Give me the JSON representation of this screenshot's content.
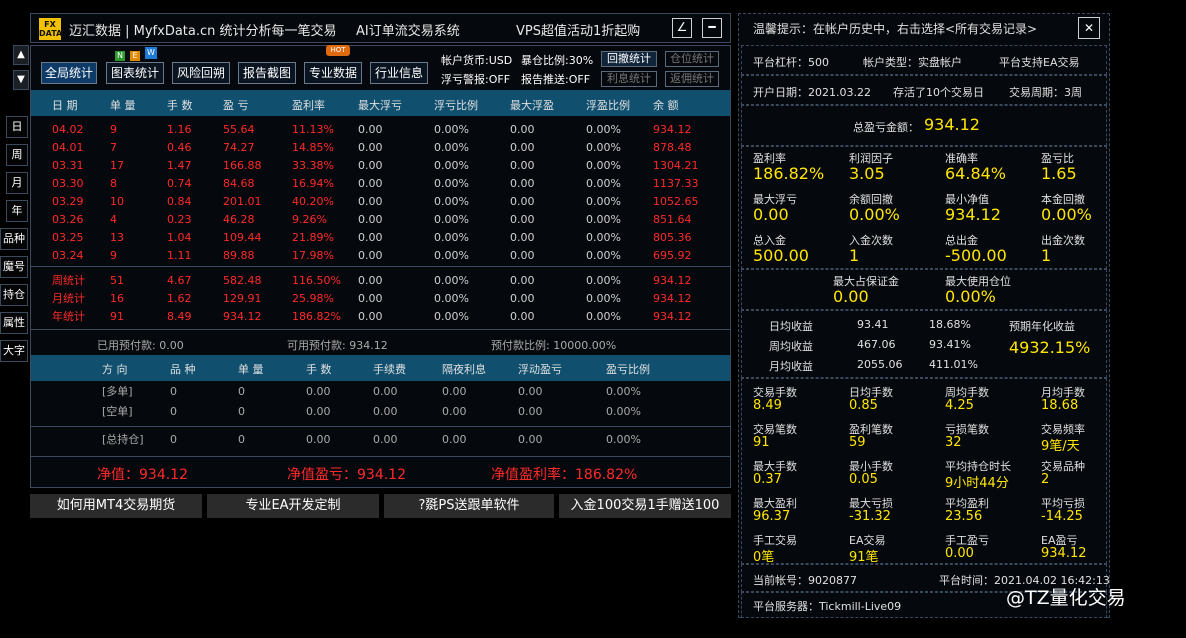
{
  "title": {
    "logo_top": "FX",
    "logo_bottom": "DATA",
    "app": "迈汇数据 | MyfxData.cn  统计分析每一笔交易",
    "ai": "AI订单流交易系统",
    "vps": "VPS超值活动1折起购",
    "btn_edit": "∠",
    "btn_min": "━"
  },
  "side": {
    "up": "▲",
    "down": "▼",
    "tabs": [
      "日",
      "周",
      "月",
      "年",
      "品种",
      "魔号",
      "持仓",
      "属性",
      "大字"
    ]
  },
  "toolbar": {
    "buttons": [
      "全局统计",
      "图表统计",
      "风险回朔",
      "报告截图",
      "专业数据",
      "行业信息"
    ],
    "new_badge": [
      "N",
      "E",
      "W"
    ],
    "hot_badge": "HOT",
    "currency": "帐户货币:USD",
    "ratio": "暴仓比例:30%",
    "warn": "浮亏警报:OFF",
    "push": "报告推送:OFF",
    "small": [
      "回撤统计",
      "仓位统计",
      "利息统计",
      "返佣统计"
    ]
  },
  "table": {
    "headers": [
      "日 期",
      "单 量",
      "手 数",
      "盈 亏",
      "盈利率",
      "最大浮亏",
      "浮亏比例",
      "最大浮盈",
      "浮盈比例",
      "余 额"
    ],
    "rows": [
      [
        "04.02",
        "9",
        "1.16",
        "55.64",
        "11.13%",
        "0.00",
        "0.00%",
        "0.00",
        "0.00%",
        "934.12"
      ],
      [
        "04.01",
        "7",
        "0.46",
        "74.27",
        "14.85%",
        "0.00",
        "0.00%",
        "0.00",
        "0.00%",
        "878.48"
      ],
      [
        "03.31",
        "17",
        "1.47",
        "166.88",
        "33.38%",
        "0.00",
        "0.00%",
        "0.00",
        "0.00%",
        "1304.21"
      ],
      [
        "03.30",
        "8",
        "0.74",
        "84.68",
        "16.94%",
        "0.00",
        "0.00%",
        "0.00",
        "0.00%",
        "1137.33"
      ],
      [
        "03.29",
        "10",
        "0.84",
        "201.01",
        "40.20%",
        "0.00",
        "0.00%",
        "0.00",
        "0.00%",
        "1052.65"
      ],
      [
        "03.26",
        "4",
        "0.23",
        "46.28",
        "9.26%",
        "0.00",
        "0.00%",
        "0.00",
        "0.00%",
        "851.64"
      ],
      [
        "03.25",
        "13",
        "1.04",
        "109.44",
        "21.89%",
        "0.00",
        "0.00%",
        "0.00",
        "0.00%",
        "805.36"
      ],
      [
        "03.24",
        "9",
        "1.11",
        "89.88",
        "17.98%",
        "0.00",
        "0.00%",
        "0.00",
        "0.00%",
        "695.92"
      ]
    ],
    "summary": [
      [
        "周统计",
        "51",
        "4.67",
        "582.48",
        "116.50%",
        "0.00",
        "0.00%",
        "0.00",
        "0.00%",
        "934.12"
      ],
      [
        "月统计",
        "16",
        "1.62",
        "129.91",
        "25.98%",
        "0.00",
        "0.00%",
        "0.00",
        "0.00%",
        "934.12"
      ],
      [
        "年统计",
        "91",
        "8.49",
        "934.12",
        "186.82%",
        "0.00",
        "0.00%",
        "0.00",
        "0.00%",
        "934.12"
      ]
    ]
  },
  "margin": {
    "used": "已用预付款: 0.00",
    "avail": "可用预付款: 934.12",
    "ratio": "预付款比例: 10000.00%"
  },
  "pos": {
    "headers": [
      "方 向",
      "品 种",
      "单 量",
      "手 数",
      "手续费",
      "隔夜利息",
      "浮动盈亏",
      "盈亏比例"
    ],
    "rows": [
      [
        "[多单]",
        "0",
        "0",
        "0.00",
        "0.00",
        "0.00",
        "0.00",
        "0.00%"
      ],
      [
        "[空单]",
        "0",
        "0",
        "0.00",
        "0.00",
        "0.00",
        "0.00",
        "0.00%"
      ]
    ],
    "total": [
      "[总持仓]",
      "0",
      "0",
      "0.00",
      "0.00",
      "0.00",
      "0.00",
      "0.00%"
    ]
  },
  "net": {
    "value": "净值：934.12",
    "profit": "净值盈亏：934.12",
    "rate": "净值盈利率：186.82%"
  },
  "footer": [
    "如何用MT4交易期货",
    "专业EA开发定制",
    "?毲PS送跟单软件",
    "入金100交易1手赠送100"
  ],
  "right": {
    "tip": "温馨提示：在帐户历史中，右击选择<所有交易记录>",
    "close": "✕",
    "lev": "平台杠杆：500",
    "acct_type": "帐户类型：实盘帐户",
    "ea": "平台支持EA交易",
    "open": "开户日期：2021.03.22",
    "stored": "存活了10个交易日",
    "period": "交易周期：3周",
    "total_label": "总盈亏金额：",
    "total_val": "934.12",
    "g1": [
      [
        "盈利率",
        "186.82%"
      ],
      [
        "利润因子",
        "3.05"
      ],
      [
        "准确率",
        "64.84%"
      ],
      [
        "盈亏比",
        "1.65"
      ],
      [
        "最大浮亏",
        "0.00"
      ],
      [
        "余额回撤",
        "0.00%"
      ],
      [
        "最小净值",
        "934.12"
      ],
      [
        "本金回撤",
        "0.00%"
      ],
      [
        "总入金",
        "500.00"
      ],
      [
        "入金次数",
        "1"
      ],
      [
        "总出金",
        "-500.00"
      ],
      [
        "出金次数",
        "1"
      ]
    ],
    "margin_max": [
      "最大占保证金",
      "0.00"
    ],
    "pos_max": [
      "最大使用仓位",
      "0.00%"
    ],
    "inc": [
      [
        "日均收益",
        "93.41",
        "18.68%"
      ],
      [
        "周均收益",
        "467.06",
        "93.41%"
      ],
      [
        "月均收益",
        "2055.06",
        "411.01%"
      ]
    ],
    "annual_label": "预期年化收益",
    "annual_val": "4932.15%",
    "g2": [
      [
        "交易手数",
        "8.49"
      ],
      [
        "日均手数",
        "0.85"
      ],
      [
        "周均手数",
        "4.25"
      ],
      [
        "月均手数",
        "18.68"
      ],
      [
        "交易笔数",
        "91"
      ],
      [
        "盈利笔数",
        "59"
      ],
      [
        "亏损笔数",
        "32"
      ],
      [
        "交易频率",
        "9笔/天"
      ],
      [
        "最大手数",
        "0.37"
      ],
      [
        "最小手数",
        "0.05"
      ],
      [
        "平均持仓时长",
        "9小时44分"
      ],
      [
        "交易品种",
        "2"
      ],
      [
        "最大盈利",
        "96.37"
      ],
      [
        "最大亏损",
        "-31.32"
      ],
      [
        "平均盈利",
        "23.56"
      ],
      [
        "平均亏损",
        "-14.25"
      ],
      [
        "手工交易",
        "0笔"
      ],
      [
        "EA交易",
        "91笔"
      ],
      [
        "手工盈亏",
        "0.00"
      ],
      [
        "EA盈亏",
        "934.12"
      ]
    ],
    "cur_acct": "当前帐号：9020877",
    "plat_time": "平台时间：2021.04.02 16:42:13",
    "server": "平台服务器：Tickmill-Live09"
  },
  "watermark": "@TZ量化交易"
}
